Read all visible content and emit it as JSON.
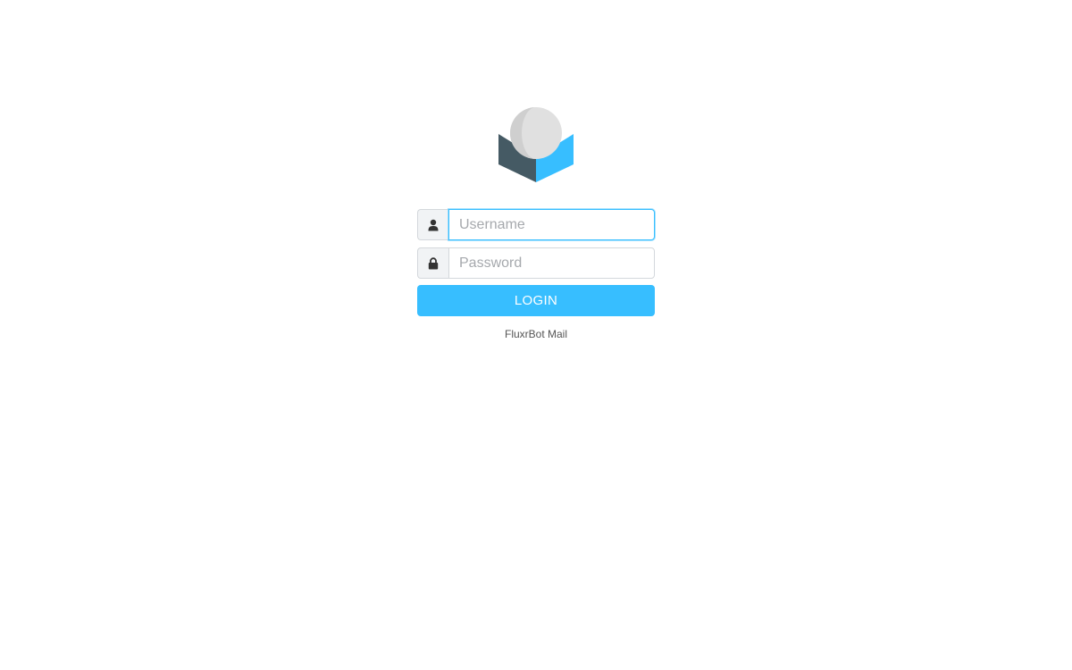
{
  "logo": {
    "icon": "roundcube-logo-icon"
  },
  "login": {
    "username_placeholder": "Username",
    "username_value": "",
    "password_placeholder": "Password",
    "password_value": "",
    "username_icon": "user-icon",
    "password_icon": "lock-icon",
    "button_label": "LOGIN"
  },
  "footer": {
    "product_name": "FluxrBot Mail"
  },
  "colors": {
    "accent": "#37beff",
    "dark": "#455a64",
    "border": "#d4d8dc"
  }
}
